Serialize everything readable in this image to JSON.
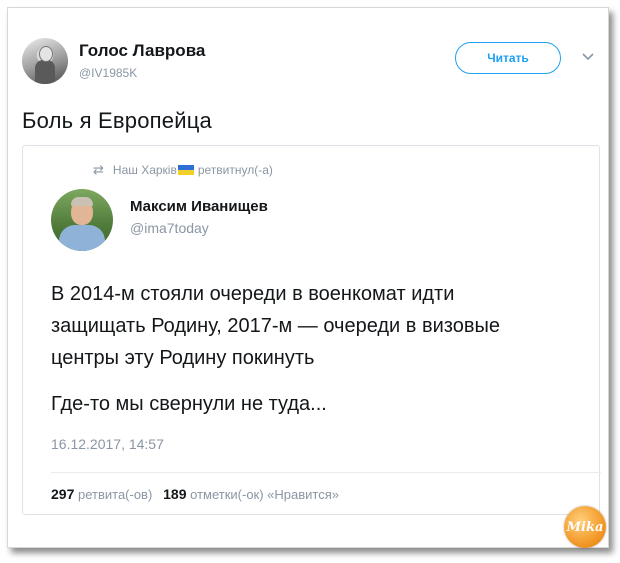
{
  "tweet": {
    "author_name": "Голос Лаврова",
    "author_handle": "@IV1985K",
    "follow_label": "Читать",
    "text": "Боль я Европейца"
  },
  "quote": {
    "retweet_icon": "retweet-icon",
    "retweeted_by": "Наш Харків",
    "retweet_suffix": "ретвитнул(-а)",
    "author_name": "Максим Иванищев",
    "author_handle": "@ima7today",
    "body_line1": "В 2014-м стояли очереди в военкомат идти",
    "body_line2": "защищать Родину, 2017-м — очереди в визовые",
    "body_line3": "центры эту Родину покинуть",
    "body_line4": "Где-то мы свернули не туда...",
    "date": "16.12.2017, 14:57",
    "retweets_count": "297",
    "retweets_label": "ретвита(-ов)",
    "likes_count": "189",
    "likes_label": "отметки(-ок) «Нравится»"
  },
  "watermark": {
    "text": "Mika"
  },
  "colors": {
    "accent": "#1da1f2",
    "muted": "#8a96a3",
    "text": "#14171a",
    "logo": "#f39a2a"
  }
}
